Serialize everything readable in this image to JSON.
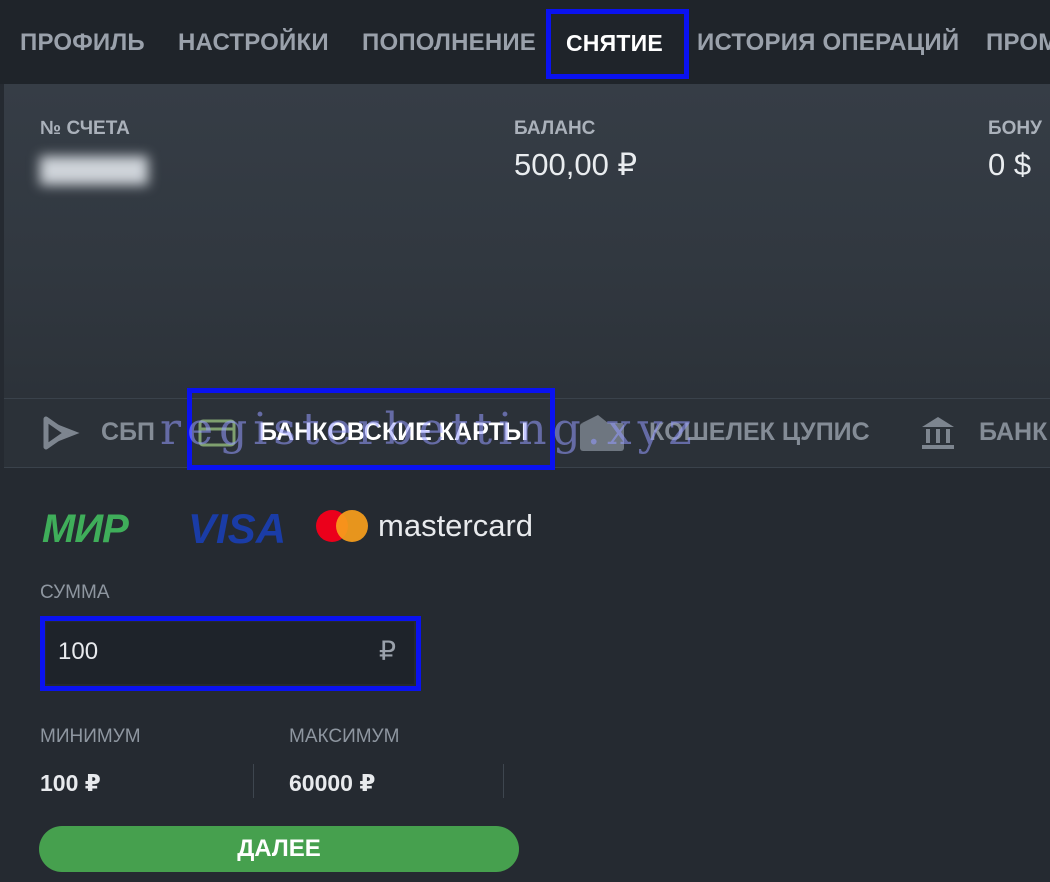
{
  "nav": {
    "tabs": [
      {
        "label": "ПРОФИЛЬ"
      },
      {
        "label": "НАСТРОЙКИ"
      },
      {
        "label": "ПОПОЛНЕНИЕ"
      },
      {
        "label": "СНЯТИЕ",
        "active": true
      },
      {
        "label": "ИСТОРИЯ ОПЕРАЦИЙ"
      },
      {
        "label": "ПРОМ"
      }
    ]
  },
  "account": {
    "number_label": "№ СЧЕТА",
    "balance_label": "БАЛАНС",
    "balance_value": "500,00 ₽",
    "bonus_label": "БОНУ",
    "bonus_value": "0 $"
  },
  "methods": [
    {
      "label": "СБП",
      "icon": "bluetooth-like-sbp-icon"
    },
    {
      "label": "БАНКОВСКИЕ КАРТЫ",
      "icon": "card-icon",
      "active": true
    },
    {
      "label": "КОШЕЛЕК ЦУПИС",
      "icon": "wallet-icon"
    },
    {
      "label": "БАНК",
      "icon": "bank-icon"
    }
  ],
  "watermark": "registerbetting.xyz",
  "card_logos": {
    "mir": "МИР",
    "visa": "VISA",
    "mastercard": "mastercard"
  },
  "amount": {
    "label": "СУММА",
    "value": "100",
    "currency": "₽"
  },
  "limits": {
    "min_label": "МИНИМУМ",
    "min_value": "100 ₽",
    "max_label": "МАКСИМУМ",
    "max_value": "60000 ₽"
  },
  "next_button": "ДАЛЕЕ",
  "colors": {
    "highlight": "#0a12f0",
    "button": "#46a04e",
    "mir": "#3fae5a",
    "visa": "#1a3ca6",
    "mc_red": "#eb001b",
    "mc_orange": "#f79e1b"
  }
}
